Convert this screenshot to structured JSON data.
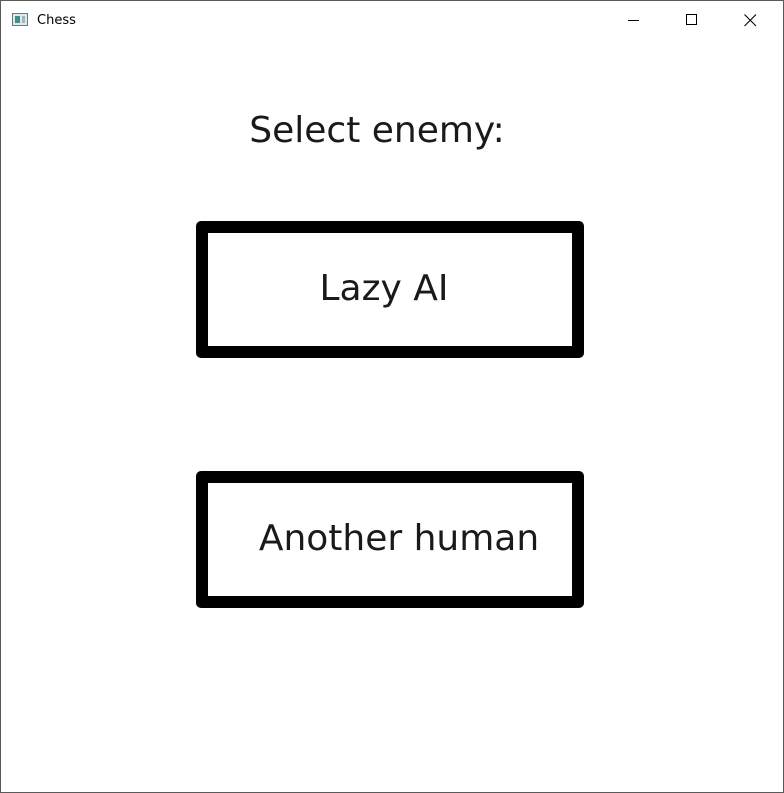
{
  "window": {
    "title": "Chess",
    "icon": "app-window-icon"
  },
  "controls": {
    "minimize": "minimize-icon",
    "maximize": "maximize-icon",
    "close": "close-icon"
  },
  "screen": {
    "heading": "Select enemy:",
    "options": [
      {
        "label": "Lazy AI"
      },
      {
        "label": "Another human"
      }
    ]
  },
  "colors": {
    "background": "#ffffff",
    "button_border": "#000000",
    "text": "#1a1a1a"
  }
}
